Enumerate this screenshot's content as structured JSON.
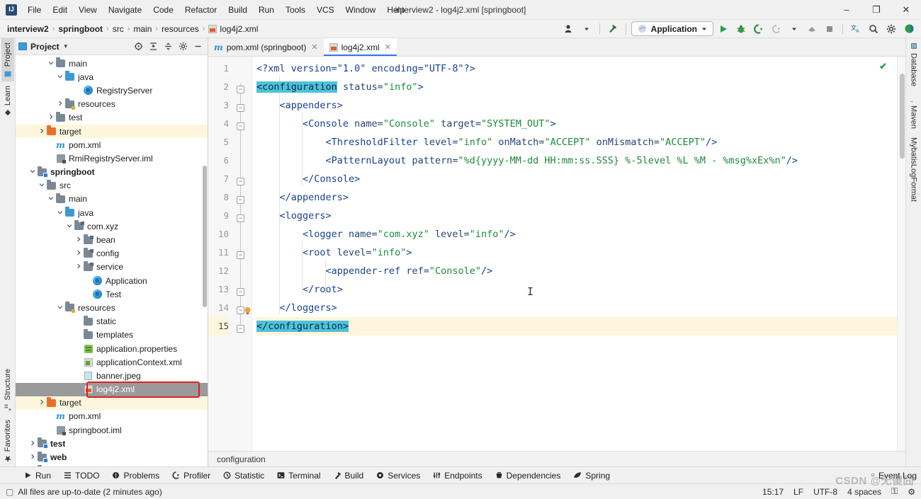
{
  "window": {
    "title": "interview2 - log4j2.xml [springboot]",
    "logo_text": "IJ",
    "minimize": "–",
    "maximize": "❐",
    "close": "✕"
  },
  "menubar": [
    {
      "label": "File"
    },
    {
      "label": "Edit"
    },
    {
      "label": "View"
    },
    {
      "label": "Navigate"
    },
    {
      "label": "Code"
    },
    {
      "label": "Refactor"
    },
    {
      "label": "Build"
    },
    {
      "label": "Run"
    },
    {
      "label": "Tools"
    },
    {
      "label": "VCS"
    },
    {
      "label": "Window"
    },
    {
      "label": "Help"
    }
  ],
  "breadcrumb": {
    "items": [
      {
        "label": "interview2",
        "bold": true,
        "icon": ""
      },
      {
        "label": "springboot",
        "bold": true,
        "icon": ""
      },
      {
        "label": "src",
        "bold": false,
        "icon": ""
      },
      {
        "label": "main",
        "bold": false,
        "icon": ""
      },
      {
        "label": "resources",
        "bold": false,
        "icon": ""
      },
      {
        "label": "log4j2.xml",
        "bold": false,
        "icon": "xml-file-icon"
      }
    ],
    "separator": "›"
  },
  "toolbar": {
    "run_config_label": "Application",
    "run_config_caret": "▼",
    "icons": [
      {
        "name": "user-avatar-icon",
        "glyph": "♟"
      },
      {
        "name": "build-hammer-icon",
        "glyph": "⚒"
      },
      {
        "name": "run-icon",
        "glyph": "▶"
      },
      {
        "name": "debug-icon",
        "glyph": "☲"
      },
      {
        "name": "run-with-coverage-icon",
        "glyph": "⧉"
      },
      {
        "name": "profile-icon",
        "glyph": "◎"
      },
      {
        "name": "more-run-icon",
        "glyph": "▼"
      },
      {
        "name": "attach-process-icon",
        "glyph": "⬟"
      },
      {
        "name": "stop-icon",
        "glyph": "■"
      },
      {
        "name": "translate-icon",
        "glyph": "文"
      },
      {
        "name": "search-everywhere-icon",
        "glyph": "⌕"
      },
      {
        "name": "settings-gear-icon",
        "glyph": "⚙"
      },
      {
        "name": "update-project-icon",
        "glyph": "◐"
      }
    ]
  },
  "left_stripe": {
    "top": [
      {
        "label": "Project",
        "icon": "project-icon",
        "active": true
      },
      {
        "label": "Learn",
        "icon": "learn-icon",
        "active": false
      }
    ],
    "bottom": [
      {
        "label": "Structure",
        "icon": "structure-icon",
        "active": false
      },
      {
        "label": "Favorites",
        "icon": "favorites-star-icon",
        "active": false
      }
    ]
  },
  "right_stripe": {
    "top": [
      {
        "label": "Database",
        "icon": "database-icon"
      },
      {
        "label": "Maven",
        "icon": "maven-icon"
      },
      {
        "label": "MybatisLogFormat",
        "icon": "mybatis-icon"
      }
    ]
  },
  "project_panel": {
    "title": "Project",
    "title_caret": "▼",
    "header_icons": [
      {
        "name": "locate-file-icon",
        "glyph": "⊕"
      },
      {
        "name": "expand-all-icon",
        "glyph": "↧"
      },
      {
        "name": "collapse-all-icon",
        "glyph": "↥"
      },
      {
        "name": "panel-settings-gear-icon",
        "glyph": "⚙"
      },
      {
        "name": "hide-panel-icon",
        "glyph": "–"
      }
    ],
    "tree": [
      {
        "label": "main",
        "indent": 3,
        "arrow": "down",
        "icon": "folder-gray",
        "state": ""
      },
      {
        "label": "java",
        "indent": 4,
        "arrow": "down",
        "icon": "folder-blue",
        "state": ""
      },
      {
        "label": "RegistryServer",
        "indent": 6,
        "arrow": "none",
        "icon": "class",
        "state": ""
      },
      {
        "label": "resources",
        "indent": 4,
        "arrow": "right",
        "icon": "folder-src",
        "state": ""
      },
      {
        "label": "test",
        "indent": 3,
        "arrow": "right",
        "icon": "folder-gray",
        "state": ""
      },
      {
        "label": "target",
        "indent": 2,
        "arrow": "right",
        "icon": "folder-orange",
        "state": "highlight"
      },
      {
        "label": "pom.xml",
        "indent": 3,
        "arrow": "none",
        "icon": "maven-m",
        "state": ""
      },
      {
        "label": "RmiRegistryServer.iml",
        "indent": 3,
        "arrow": "none",
        "icon": "iml",
        "state": ""
      },
      {
        "label": "springboot",
        "indent": 1,
        "arrow": "down",
        "icon": "folder-module",
        "state": "bold"
      },
      {
        "label": "src",
        "indent": 2,
        "arrow": "down",
        "icon": "folder-gray",
        "state": ""
      },
      {
        "label": "main",
        "indent": 3,
        "arrow": "down",
        "icon": "folder-gray",
        "state": ""
      },
      {
        "label": "java",
        "indent": 4,
        "arrow": "down",
        "icon": "folder-blue",
        "state": ""
      },
      {
        "label": "com.xyz",
        "indent": 5,
        "arrow": "down",
        "icon": "folder-pkg",
        "state": ""
      },
      {
        "label": "bean",
        "indent": 6,
        "arrow": "right",
        "icon": "folder-pkg",
        "state": ""
      },
      {
        "label": "config",
        "indent": 6,
        "arrow": "right",
        "icon": "folder-pkg",
        "state": ""
      },
      {
        "label": "service",
        "indent": 6,
        "arrow": "right",
        "icon": "folder-pkg",
        "state": ""
      },
      {
        "label": "Application",
        "indent": 7,
        "arrow": "none",
        "icon": "class",
        "state": ""
      },
      {
        "label": "Test",
        "indent": 7,
        "arrow": "none",
        "icon": "class",
        "state": ""
      },
      {
        "label": "resources",
        "indent": 4,
        "arrow": "down",
        "icon": "folder-src",
        "state": ""
      },
      {
        "label": "static",
        "indent": 6,
        "arrow": "none",
        "icon": "folder-gray",
        "state": ""
      },
      {
        "label": "templates",
        "indent": 6,
        "arrow": "none",
        "icon": "folder-gray",
        "state": ""
      },
      {
        "label": "application.properties",
        "indent": 6,
        "arrow": "none",
        "icon": "properties",
        "state": ""
      },
      {
        "label": "applicationContext.xml",
        "indent": 6,
        "arrow": "none",
        "icon": "spring-xml",
        "state": ""
      },
      {
        "label": "banner.jpeg",
        "indent": 6,
        "arrow": "none",
        "icon": "image",
        "state": ""
      },
      {
        "label": "log4j2.xml",
        "indent": 6,
        "arrow": "none",
        "icon": "xml",
        "state": "selected"
      },
      {
        "label": "target",
        "indent": 2,
        "arrow": "right",
        "icon": "folder-orange",
        "state": "highlight"
      },
      {
        "label": "pom.xml",
        "indent": 3,
        "arrow": "none",
        "icon": "maven-m",
        "state": ""
      },
      {
        "label": "springboot.iml",
        "indent": 3,
        "arrow": "none",
        "icon": "iml",
        "state": ""
      },
      {
        "label": "test",
        "indent": 1,
        "arrow": "right",
        "icon": "folder-module",
        "state": "bold"
      },
      {
        "label": "web",
        "indent": 1,
        "arrow": "right",
        "icon": "folder-module",
        "state": "bold"
      },
      {
        "label": "web-bom",
        "indent": 1,
        "arrow": "right",
        "icon": "folder-module",
        "state": "bold"
      }
    ]
  },
  "editor": {
    "tabs": [
      {
        "label": "pom.xml (springboot)",
        "icon": "maven-m",
        "active": false,
        "close": "✕"
      },
      {
        "label": "log4j2.xml",
        "icon": "xml",
        "active": true,
        "close": "✕"
      }
    ],
    "breadcrumb": "configuration",
    "inspection_status": "✔",
    "line_numbers": [
      "1",
      "2",
      "3",
      "4",
      "5",
      "6",
      "7",
      "8",
      "9",
      "10",
      "11",
      "12",
      "13",
      "14",
      "15"
    ],
    "current_line": 15,
    "lightbulb_line": 14,
    "lines": [
      {
        "n": 1,
        "tokens": [
          {
            "t": "<?xml version=\"1.0\" encoding=\"UTF-8\"?>",
            "c": "pi"
          }
        ]
      },
      {
        "n": 2,
        "tokens": [
          {
            "t": "<configuration",
            "c": "match"
          },
          {
            "t": " ",
            "c": "plain"
          },
          {
            "t": "status=",
            "c": "attr"
          },
          {
            "t": "\"info\"",
            "c": "val"
          },
          {
            "t": ">",
            "c": "tag"
          }
        ]
      },
      {
        "n": 3,
        "tokens": [
          {
            "t": "    <appenders>",
            "c": "tag"
          }
        ]
      },
      {
        "n": 4,
        "tokens": [
          {
            "t": "        <Console ",
            "c": "tag"
          },
          {
            "t": "name=",
            "c": "attr"
          },
          {
            "t": "\"Console\"",
            "c": "val"
          },
          {
            "t": " ",
            "c": "plain"
          },
          {
            "t": "target=",
            "c": "attr"
          },
          {
            "t": "\"SYSTEM_OUT\"",
            "c": "val"
          },
          {
            "t": ">",
            "c": "tag"
          }
        ]
      },
      {
        "n": 5,
        "tokens": [
          {
            "t": "            <ThresholdFilter ",
            "c": "tag"
          },
          {
            "t": "level=",
            "c": "attr"
          },
          {
            "t": "\"info\"",
            "c": "val"
          },
          {
            "t": " ",
            "c": "plain"
          },
          {
            "t": "onMatch=",
            "c": "attr"
          },
          {
            "t": "\"ACCEPT\"",
            "c": "val"
          },
          {
            "t": " ",
            "c": "plain"
          },
          {
            "t": "onMismatch=",
            "c": "attr"
          },
          {
            "t": "\"ACCEPT\"",
            "c": "val"
          },
          {
            "t": "/>",
            "c": "tag"
          }
        ]
      },
      {
        "n": 6,
        "tokens": [
          {
            "t": "            <PatternLayout ",
            "c": "tag"
          },
          {
            "t": "pattern=",
            "c": "attr"
          },
          {
            "t": "\"%d{yyyy-MM-dd HH:mm:ss.SSS} %-5level %L %M - %msg%xEx%n\"",
            "c": "val"
          },
          {
            "t": "/>",
            "c": "tag"
          }
        ]
      },
      {
        "n": 7,
        "tokens": [
          {
            "t": "        </Console>",
            "c": "tag"
          }
        ]
      },
      {
        "n": 8,
        "tokens": [
          {
            "t": "    </appenders>",
            "c": "tag"
          }
        ]
      },
      {
        "n": 9,
        "tokens": [
          {
            "t": "    <loggers>",
            "c": "tag"
          }
        ]
      },
      {
        "n": 10,
        "tokens": [
          {
            "t": "        <logger ",
            "c": "tag"
          },
          {
            "t": "name=",
            "c": "attr"
          },
          {
            "t": "\"com.xyz\"",
            "c": "val"
          },
          {
            "t": " ",
            "c": "plain"
          },
          {
            "t": "level=",
            "c": "attr"
          },
          {
            "t": "\"info\"",
            "c": "val"
          },
          {
            "t": "/>",
            "c": "tag"
          }
        ]
      },
      {
        "n": 11,
        "tokens": [
          {
            "t": "        <root ",
            "c": "tag"
          },
          {
            "t": "level=",
            "c": "attr"
          },
          {
            "t": "\"info\"",
            "c": "val"
          },
          {
            "t": ">",
            "c": "tag"
          }
        ]
      },
      {
        "n": 12,
        "tokens": [
          {
            "t": "            <appender-ref ",
            "c": "tag"
          },
          {
            "t": "ref=",
            "c": "attr"
          },
          {
            "t": "\"Console\"",
            "c": "val"
          },
          {
            "t": "/>",
            "c": "tag"
          }
        ]
      },
      {
        "n": 13,
        "tokens": [
          {
            "t": "        </root>",
            "c": "tag"
          }
        ]
      },
      {
        "n": 14,
        "tokens": [
          {
            "t": "    </loggers>",
            "c": "tag"
          }
        ]
      },
      {
        "n": 15,
        "tokens": [
          {
            "t": "</configuration>",
            "c": "match"
          }
        ]
      }
    ]
  },
  "tool_window_bar": {
    "items": [
      {
        "label": "Run",
        "icon": "run-icon",
        "glyph": "▶"
      },
      {
        "label": "TODO",
        "icon": "todo-icon",
        "glyph": "≣"
      },
      {
        "label": "Problems",
        "icon": "problems-icon",
        "glyph": "ⓘ"
      },
      {
        "label": "Profiler",
        "icon": "profiler-icon",
        "glyph": "◔"
      },
      {
        "label": "Statistic",
        "icon": "statistic-icon",
        "glyph": "◴"
      },
      {
        "label": "Terminal",
        "icon": "terminal-icon",
        "glyph": "▣"
      },
      {
        "label": "Build",
        "icon": "build-hammer-icon",
        "glyph": "⚒"
      },
      {
        "label": "Services",
        "icon": "services-icon",
        "glyph": "⚙"
      },
      {
        "label": "Endpoints",
        "icon": "endpoints-icon",
        "glyph": "⑂"
      },
      {
        "label": "Dependencies",
        "icon": "dependencies-icon",
        "glyph": "⛁"
      },
      {
        "label": "Spring",
        "icon": "spring-leaf-icon",
        "glyph": "❦"
      }
    ],
    "event_log": {
      "label": "Event Log",
      "glyph": "○"
    }
  },
  "statusbar": {
    "message": "All files are up-to-date (2 minutes ago)",
    "message_icon": "▢",
    "time": "15:17",
    "line_separator": "LF",
    "encoding": "UTF-8",
    "indent": "4 spaces",
    "lock_icon": "⚿",
    "inspection_icon": "⚙"
  },
  "watermark": "CSDN @无傻囧",
  "colors": {
    "accent_blue": "#3574f0",
    "tag": "#17418f",
    "value_green": "#1f8a3b",
    "match_highlight": "#4fc3d9",
    "selection_gray": "#9a9a9a",
    "annotation_red": "#e02020",
    "highlight_yellow": "#fdf6dd"
  }
}
